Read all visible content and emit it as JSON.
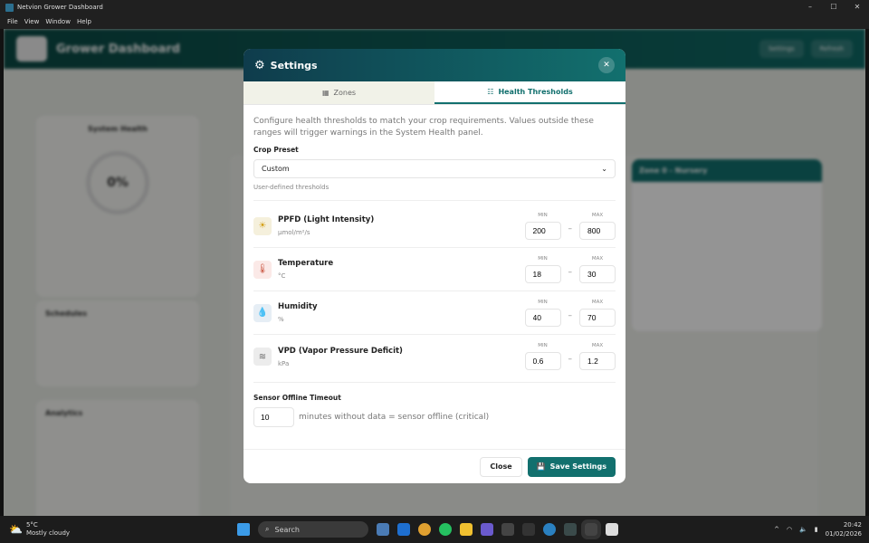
{
  "window": {
    "title": "Netvion Grower Dashboard",
    "menu": [
      "File",
      "View",
      "Window",
      "Help"
    ]
  },
  "background": {
    "app_title": "Grower Dashboard",
    "header_buttons": [
      "Settings",
      "Refresh"
    ],
    "panels": [
      "System Health",
      "Schedules",
      "Analytics"
    ],
    "health_score": "0%",
    "zone_title": "Zone 0 - Nursery"
  },
  "modal": {
    "title": "Settings",
    "tabs": [
      {
        "label": "Zones",
        "active": false
      },
      {
        "label": "Health Thresholds",
        "active": true
      }
    ],
    "description": "Configure health thresholds to match your crop requirements. Values outside these ranges will trigger warnings in the System Health panel.",
    "crop_preset": {
      "label": "Crop Preset",
      "value": "Custom",
      "hint": "User-defined thresholds"
    },
    "min_label": "MIN",
    "max_label": "MAX",
    "range_sep": "–",
    "thresholds": [
      {
        "name": "PPFD (Light Intensity)",
        "unit": "µmol/m²/s",
        "min": "200",
        "max": "800",
        "icon": "sun-icon",
        "color": "#f5f0dc",
        "glyph": "☀",
        "glyph_color": "#d4a017"
      },
      {
        "name": "Temperature",
        "unit": "°C",
        "min": "18",
        "max": "30",
        "icon": "thermometer-icon",
        "color": "#fbe9e7",
        "glyph": "🌡",
        "glyph_color": "#c9533f"
      },
      {
        "name": "Humidity",
        "unit": "%",
        "min": "40",
        "max": "70",
        "icon": "droplet-icon",
        "color": "#e6eef5",
        "glyph": "💧",
        "glyph_color": "#3f7fb5"
      },
      {
        "name": "VPD (Vapor Pressure Deficit)",
        "unit": "kPa",
        "min": "0.6",
        "max": "1.2",
        "icon": "wind-icon",
        "color": "#ececec",
        "glyph": "≋",
        "glyph_color": "#666"
      }
    ],
    "timeout": {
      "label": "Sensor Offline Timeout",
      "value": "10",
      "suffix": "minutes without data = sensor offline (critical)"
    },
    "close_label": "Close",
    "save_label": "Save Settings"
  },
  "taskbar": {
    "temp": "5°C",
    "weather": "Mostly cloudy",
    "search": "Search",
    "time": "20:42",
    "date": "01/02/2026"
  }
}
